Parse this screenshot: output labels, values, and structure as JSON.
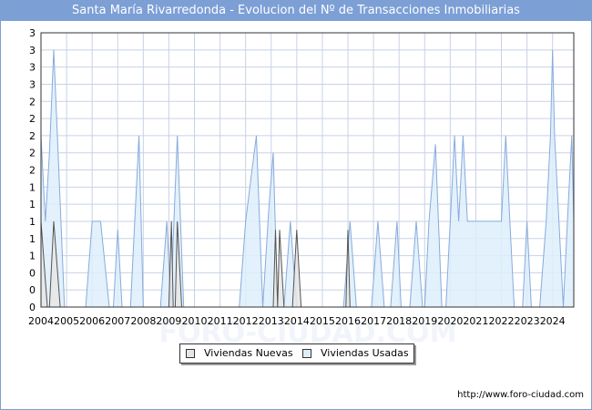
{
  "title": "Santa María Rivarredonda - Evolucion del Nº de Transacciones Inmobiliarias",
  "source_url": "http://www.foro-ciudad.com",
  "watermark": "FORO-CIUDAD.COM",
  "colors": {
    "title_bg": "#7c9fd6",
    "grid": "#c8d2e6",
    "nuevas_fill": "#e6e6e6",
    "nuevas_line": "#555555",
    "usadas_fill": "#ddeefa",
    "usadas_line": "#88aadd"
  },
  "chart_data": {
    "type": "area",
    "title": "Santa María Rivarredonda - Evolucion del Nº de Transacciones Inmobiliarias",
    "xlabel": "",
    "ylabel": "",
    "xlim": [
      2004,
      2024.83
    ],
    "ylim": [
      0,
      3.2
    ],
    "y_ticks": [
      0,
      0.2,
      0.4,
      0.6,
      0.8,
      1.0,
      1.2,
      1.4,
      1.6,
      1.8,
      2.0,
      2.2,
      2.4,
      2.6,
      2.8,
      3.0,
      3.2
    ],
    "y_tick_labels": [
      "0",
      "0",
      "0",
      "1",
      "1",
      "1",
      "1",
      "1",
      "2",
      "2",
      "2",
      "2",
      "2",
      "3",
      "3",
      "3",
      "3"
    ],
    "x_tick_labels": [
      "2004",
      "2005",
      "2006",
      "2007",
      "2008",
      "2009",
      "2010",
      "2011",
      "2012",
      "2013",
      "2014",
      "2015",
      "2016",
      "2017",
      "2018",
      "2019",
      "2020",
      "2021",
      "2022",
      "2023",
      "2024"
    ],
    "grid": true,
    "legend_position": "bottom",
    "series": [
      {
        "name": "Viviendas Nuevas",
        "points": [
          [
            2004.0,
            1.0
          ],
          [
            2004.25,
            0.0
          ],
          [
            2004.33,
            0.0
          ],
          [
            2004.5,
            1.0
          ],
          [
            2004.75,
            0.0
          ],
          [
            2009.0,
            0.0
          ],
          [
            2009.1,
            1.0
          ],
          [
            2009.17,
            0.0
          ],
          [
            2009.25,
            0.0
          ],
          [
            2009.33,
            1.0
          ],
          [
            2009.5,
            0.0
          ],
          [
            2013.0,
            0.0
          ],
          [
            2013.08,
            0.0
          ],
          [
            2013.17,
            0.9
          ],
          [
            2013.25,
            0.0
          ],
          [
            2013.33,
            0.9
          ],
          [
            2013.5,
            0.0
          ],
          [
            2013.83,
            0.0
          ],
          [
            2014.0,
            0.9
          ],
          [
            2014.17,
            0.0
          ],
          [
            2015.75,
            0.0
          ],
          [
            2015.92,
            0.0
          ],
          [
            2016.0,
            0.9
          ],
          [
            2016.08,
            0.0
          ],
          [
            2016.17,
            0.0
          ]
        ]
      },
      {
        "name": "Viviendas Usadas",
        "points": [
          [
            2004.0,
            2.0
          ],
          [
            2004.17,
            1.0
          ],
          [
            2004.33,
            1.8
          ],
          [
            2004.5,
            3.0
          ],
          [
            2004.67,
            1.8
          ],
          [
            2004.92,
            0.0
          ],
          [
            2005.75,
            0.0
          ],
          [
            2006.0,
            1.0
          ],
          [
            2006.33,
            1.0
          ],
          [
            2006.67,
            0.0
          ],
          [
            2006.83,
            0.0
          ],
          [
            2007.0,
            0.9
          ],
          [
            2007.17,
            0.0
          ],
          [
            2007.5,
            0.0
          ],
          [
            2007.83,
            2.0
          ],
          [
            2008.0,
            0.0
          ],
          [
            2008.67,
            0.0
          ],
          [
            2008.92,
            1.0
          ],
          [
            2009.08,
            0.0
          ],
          [
            2009.17,
            0.8
          ],
          [
            2009.33,
            2.0
          ],
          [
            2009.58,
            0.0
          ],
          [
            2011.75,
            0.0
          ],
          [
            2012.0,
            1.0
          ],
          [
            2012.25,
            1.6
          ],
          [
            2012.42,
            2.0
          ],
          [
            2012.67,
            0.0
          ],
          [
            2012.92,
            1.2
          ],
          [
            2013.08,
            1.8
          ],
          [
            2013.25,
            0.0
          ],
          [
            2013.5,
            0.0
          ],
          [
            2013.75,
            1.0
          ],
          [
            2014.0,
            0.0
          ],
          [
            2015.83,
            0.0
          ],
          [
            2016.08,
            1.0
          ],
          [
            2016.33,
            0.0
          ],
          [
            2016.92,
            0.0
          ],
          [
            2017.17,
            1.0
          ],
          [
            2017.42,
            0.0
          ],
          [
            2017.67,
            0.0
          ],
          [
            2017.92,
            1.0
          ],
          [
            2018.08,
            0.0
          ],
          [
            2018.42,
            0.0
          ],
          [
            2018.67,
            1.0
          ],
          [
            2018.92,
            0.0
          ],
          [
            2019.0,
            0.0
          ],
          [
            2019.17,
            1.0
          ],
          [
            2019.42,
            1.9
          ],
          [
            2019.67,
            0.0
          ],
          [
            2019.83,
            0.0
          ],
          [
            2020.0,
            1.0
          ],
          [
            2020.17,
            2.0
          ],
          [
            2020.33,
            1.0
          ],
          [
            2020.5,
            2.0
          ],
          [
            2020.67,
            1.0
          ],
          [
            2022.0,
            1.0
          ],
          [
            2022.17,
            2.0
          ],
          [
            2022.33,
            1.0
          ],
          [
            2022.5,
            0.0
          ],
          [
            2022.83,
            0.0
          ],
          [
            2023.0,
            1.0
          ],
          [
            2023.17,
            0.0
          ],
          [
            2023.5,
            0.0
          ],
          [
            2023.75,
            1.0
          ],
          [
            2023.92,
            2.0
          ],
          [
            2024.0,
            3.0
          ],
          [
            2024.08,
            2.0
          ],
          [
            2024.25,
            1.0
          ],
          [
            2024.42,
            0.0
          ],
          [
            2024.58,
            1.0
          ],
          [
            2024.75,
            2.0
          ],
          [
            2024.83,
            1.0
          ]
        ]
      }
    ]
  }
}
